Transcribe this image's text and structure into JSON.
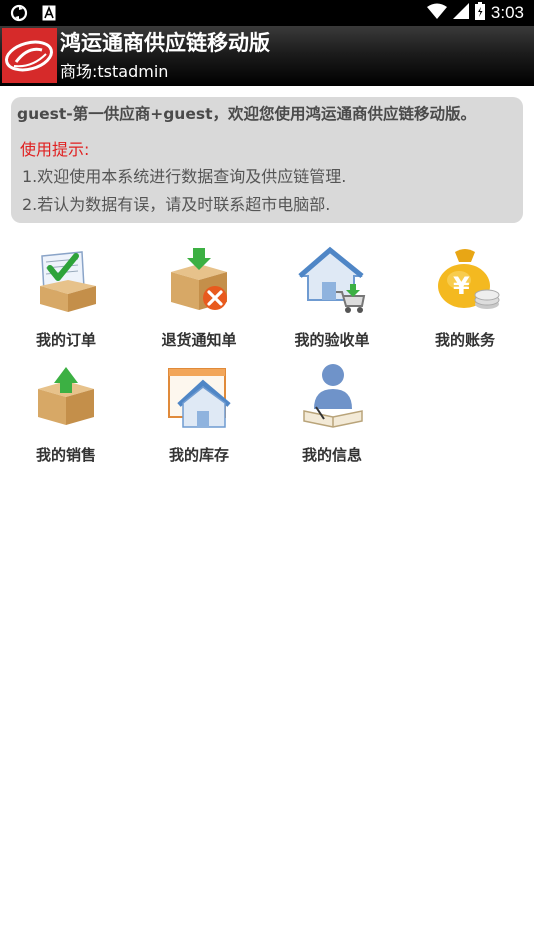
{
  "status_bar": {
    "time": "3:03"
  },
  "header": {
    "title": "鸿运通商供应链移动版",
    "subtitle": "商场:tstadmin"
  },
  "notice": {
    "welcome": "guest-第一供应商+guest，欢迎您使用鸿运通商供应链移动版。",
    "hint_title": "使用提示:",
    "line1": "1.欢迎使用本系统进行数据查询及供应链管理.",
    "line2": "2.若认为数据有误，请及时联系超市电脑部."
  },
  "menu": [
    {
      "label": "我的订单",
      "icon": "order-box-check-icon"
    },
    {
      "label": "退货通知单",
      "icon": "return-box-cancel-icon"
    },
    {
      "label": "我的验收单",
      "icon": "house-cart-icon"
    },
    {
      "label": "我的账务",
      "icon": "money-bag-coins-icon"
    },
    {
      "label": "我的销售",
      "icon": "box-up-arrow-icon"
    },
    {
      "label": "我的库存",
      "icon": "house-window-icon"
    },
    {
      "label": "我的信息",
      "icon": "person-book-icon"
    }
  ],
  "colors": {
    "header_bg": "#000000",
    "notice_bg": "#d9d9d9",
    "hint_red": "#e02020",
    "logo_red": "#d62a2a"
  }
}
